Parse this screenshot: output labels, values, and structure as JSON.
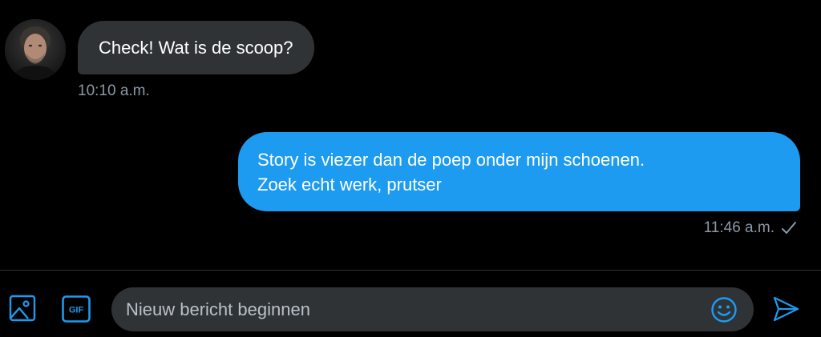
{
  "conversation": {
    "received": {
      "avatar_icon": "user-photo-avatar",
      "text": "Check! Wat is de scoop?",
      "time": "10:10 a.m.",
      "bubble_color": "#2f3336"
    },
    "sent": {
      "lines": [
        "Story is viezer dan de poep onder mijn schoenen.",
        "Zoek echt werk, prutser"
      ],
      "time": "11:46 a.m.",
      "status_icon": "check-icon",
      "bubble_color": "#1d9bf0"
    }
  },
  "composer": {
    "placeholder": "Nieuw bericht beginnen",
    "value": "",
    "media_icon": "image-icon",
    "gif_label": "GIF",
    "emoji_icon": "emoji-icon",
    "send_icon": "send-icon",
    "accent_color": "#1d9bf0"
  },
  "theme": {
    "background": "#000000",
    "muted_text": "#8b98a5"
  }
}
